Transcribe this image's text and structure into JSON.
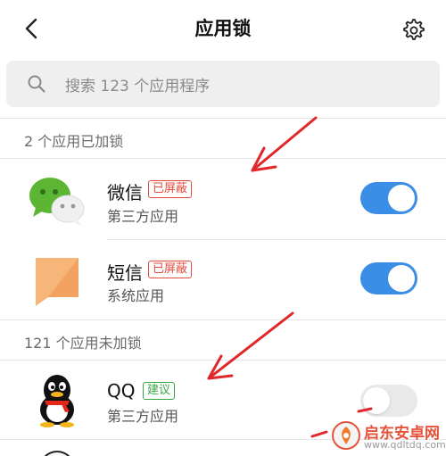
{
  "header": {
    "title": "应用锁",
    "back_icon": "chevron-left-icon",
    "settings_icon": "gear-icon"
  },
  "search": {
    "placeholder": "搜索 123 个应用程序",
    "icon": "search-icon"
  },
  "locked_section": {
    "label": "2 个应用已加锁",
    "apps": [
      {
        "name": "微信",
        "badge": "已屏蔽",
        "category": "第三方应用",
        "toggle_on": true,
        "icon": "wechat-icon"
      },
      {
        "name": "短信",
        "badge": "已屏蔽",
        "category": "系统应用",
        "toggle_on": true,
        "icon": "messages-icon"
      }
    ]
  },
  "unlocked_section": {
    "label": "121 个应用未加锁",
    "apps": [
      {
        "name": "QQ",
        "badge": "建议",
        "category": "第三方应用",
        "toggle_on": false,
        "icon": "qq-penguin-icon"
      }
    ]
  },
  "watermark": {
    "text": "启东安卓网",
    "url": "www.qdltdq.com"
  },
  "colors": {
    "toggle_on": "#3a8ee6",
    "toggle_off": "#e9e9e9",
    "badge_blocked": "#e24a3b",
    "badge_suggest": "#3aa644",
    "annotation_arrow": "#e0282b"
  }
}
